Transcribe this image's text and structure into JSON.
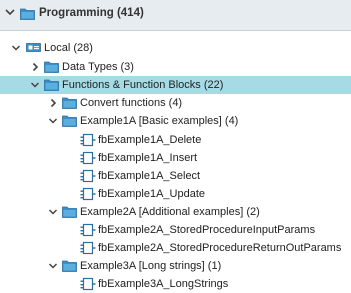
{
  "header": {
    "title": "Programming (414)"
  },
  "tree": {
    "local": "Local (28)",
    "data_types": "Data Types (3)",
    "functions": "Functions & Function Blocks (22)",
    "convert": "Convert functions (4)",
    "ex1a": "Example1A [Basic examples] (4)",
    "ex1a_items": [
      "fbExample1A_Delete",
      "fbExample1A_Insert",
      "fbExample1A_Select",
      "fbExample1A_Update"
    ],
    "ex2a": "Example2A [Additional examples] (2)",
    "ex2a_items": [
      "fbExample2A_StoredProcedureInputParams",
      "fbExample2A_StoredProcedureReturnOutParams"
    ],
    "ex3a": "Example3A [Long strings] (1)",
    "ex3a_items": [
      "fbExample3A_LongStrings"
    ]
  },
  "colors": {
    "selected_row": "#a6dbe6",
    "folder": "#3a8fc9",
    "header_bg": "#e6ecf0"
  }
}
